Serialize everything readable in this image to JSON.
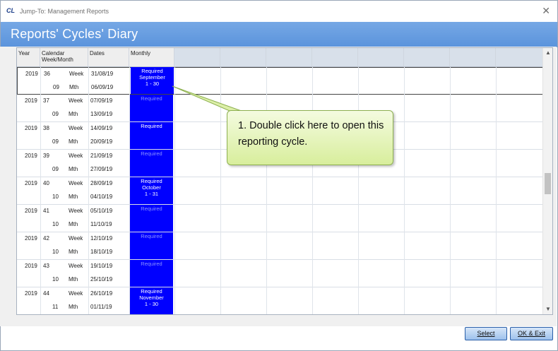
{
  "window": {
    "logo": "CL",
    "title": "Jump-To: Management Reports",
    "close_glyph": "✕"
  },
  "page": {
    "title": "Reports' Cycles' Diary"
  },
  "grid": {
    "headers": {
      "year": "Year",
      "calendar": "Calendar Week/Month",
      "dates": "Dates",
      "monthly": "Monthly"
    },
    "rows": [
      {
        "year": "2019",
        "week_no": "36",
        "week_lbl": "Week",
        "week_date": "31/08/19",
        "month_no": "09",
        "month_lbl": "Mth",
        "month_date": "06/09/19",
        "monthly": [
          "Required",
          "September",
          "1 - 30"
        ],
        "dim": false,
        "selected": true
      },
      {
        "year": "2019",
        "week_no": "37",
        "week_lbl": "Week",
        "week_date": "07/09/19",
        "month_no": "09",
        "month_lbl": "Mth",
        "month_date": "13/09/19",
        "monthly": [
          "Required"
        ],
        "dim": true,
        "selected": false
      },
      {
        "year": "2019",
        "week_no": "38",
        "week_lbl": "Week",
        "week_date": "14/09/19",
        "month_no": "09",
        "month_lbl": "Mth",
        "month_date": "20/09/19",
        "monthly": [
          "Required"
        ],
        "dim": false,
        "selected": false
      },
      {
        "year": "2019",
        "week_no": "39",
        "week_lbl": "Week",
        "week_date": "21/09/19",
        "month_no": "09",
        "month_lbl": "Mth",
        "month_date": "27/09/19",
        "monthly": [
          "Required"
        ],
        "dim": true,
        "selected": false
      },
      {
        "year": "2019",
        "week_no": "40",
        "week_lbl": "Week",
        "week_date": "28/09/19",
        "month_no": "10",
        "month_lbl": "Mth",
        "month_date": "04/10/19",
        "monthly": [
          "Required",
          "October",
          "1 - 31"
        ],
        "dim": false,
        "selected": false
      },
      {
        "year": "2019",
        "week_no": "41",
        "week_lbl": "Week",
        "week_date": "05/10/19",
        "month_no": "10",
        "month_lbl": "Mth",
        "month_date": "11/10/19",
        "monthly": [
          "Required"
        ],
        "dim": true,
        "selected": false
      },
      {
        "year": "2019",
        "week_no": "42",
        "week_lbl": "Week",
        "week_date": "12/10/19",
        "month_no": "10",
        "month_lbl": "Mth",
        "month_date": "18/10/19",
        "monthly": [
          "Required"
        ],
        "dim": true,
        "selected": false
      },
      {
        "year": "2019",
        "week_no": "43",
        "week_lbl": "Week",
        "week_date": "19/10/19",
        "month_no": "10",
        "month_lbl": "Mth",
        "month_date": "25/10/19",
        "monthly": [
          "Required"
        ],
        "dim": true,
        "selected": false
      },
      {
        "year": "2019",
        "week_no": "44",
        "week_lbl": "Week",
        "week_date": "26/10/19",
        "month_no": "11",
        "month_lbl": "Mth",
        "month_date": "01/11/19",
        "monthly": [
          "Required",
          "November",
          "1 - 30"
        ],
        "dim": false,
        "selected": false
      }
    ]
  },
  "callout": {
    "text": "1. Double  click here to open this reporting cycle."
  },
  "buttons": {
    "select": "Select",
    "ok_exit": "OK & Exit"
  },
  "scrollbar": {
    "up": "▲",
    "down": "▼"
  },
  "colors": {
    "accent_band": "#5a93dc",
    "monthly_fill": "#0000ff",
    "callout_fill": "#d8ee9c"
  }
}
